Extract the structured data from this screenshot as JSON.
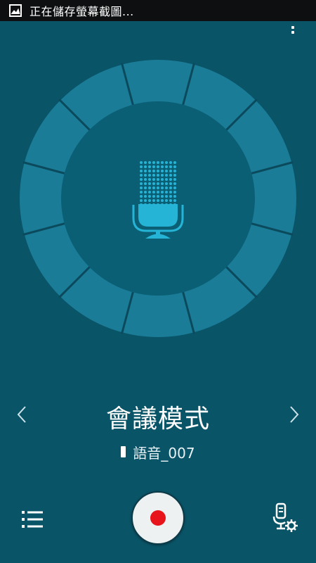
{
  "status_bar": {
    "icon": "image-icon",
    "text": "正在儲存螢幕截圖..."
  },
  "header": {
    "menu_icon": "overflow-menu-icon"
  },
  "dial": {
    "segments": 12,
    "ring_color": "#1a7c97",
    "center_color": "#0b5f75",
    "mic_color": "#25b3d6"
  },
  "mode": {
    "title": "會議模式",
    "prev_icon": "chevron-left-icon",
    "next_icon": "chevron-right-icon"
  },
  "recording": {
    "file_name": "語音_007"
  },
  "controls": {
    "list_icon": "list-icon",
    "record_icon": "record-icon",
    "record_color": "#e8141b",
    "settings_icon": "mic-settings-icon"
  },
  "colors": {
    "background": "#0a5468",
    "status_bar": "#0d0f10"
  }
}
